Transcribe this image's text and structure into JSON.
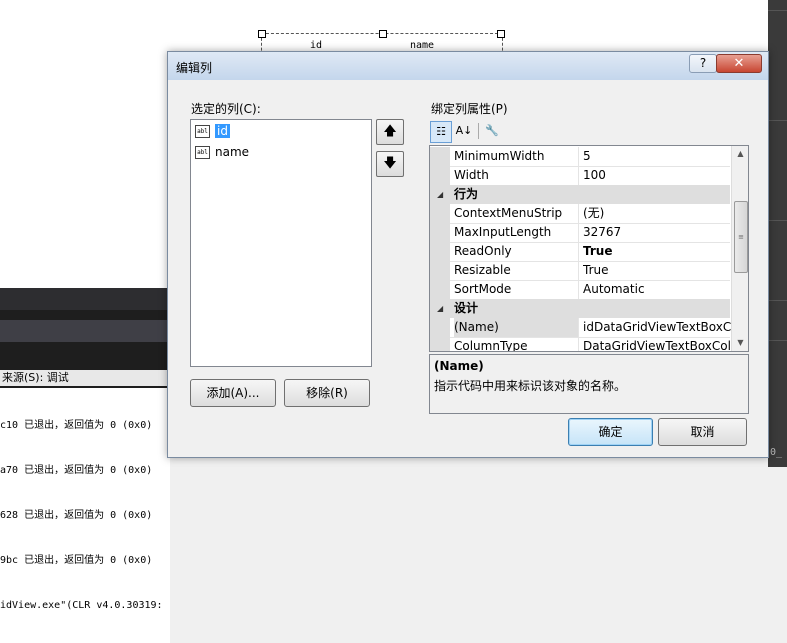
{
  "background": {
    "grid_headers": [
      "id",
      "name"
    ],
    "output": {
      "source_label": "来源(S):  调试",
      "lines": [
        "c10 已退出，返回值为 0 (0x0)",
        "a70 已退出，返回值为 0 (0x0)",
        "628 已退出，返回值为 0 (0x0)",
        "9bc 已退出，返回值为 0 (0x0)",
        "idView.exe\"(CLR v4.0.30319:"
      ]
    },
    "corner_text": "0_"
  },
  "dialog": {
    "title": "编辑列",
    "help_label": "?",
    "close_label": "✕",
    "selected_columns_label": "选定的列(C):",
    "columns": [
      {
        "label": "id",
        "selected": true,
        "icon_text": "abl"
      },
      {
        "label": "name",
        "selected": false,
        "icon_text": "abl"
      }
    ],
    "move_up_icon": "arrow-up-icon",
    "move_down_icon": "arrow-down-icon",
    "up_glyph": "🡅",
    "down_glyph": "🡇",
    "add_button": "添加(A)...",
    "remove_button": "移除(R)",
    "bound_props_label": "绑定列属性(P)",
    "toolbar": {
      "categorized_glyph": "☷",
      "alpha_glyph": "A↓",
      "pages_glyph": "🔧"
    },
    "properties": [
      {
        "kind": "prop",
        "name": "MinimumWidth",
        "value": "5"
      },
      {
        "kind": "prop",
        "name": "Width",
        "value": "100"
      },
      {
        "kind": "cat",
        "name": "行为"
      },
      {
        "kind": "prop",
        "name": "ContextMenuStrip",
        "value": "(无)"
      },
      {
        "kind": "prop",
        "name": "MaxInputLength",
        "value": "32767"
      },
      {
        "kind": "prop",
        "name": "ReadOnly",
        "value": "True",
        "bold": true
      },
      {
        "kind": "prop",
        "name": "Resizable",
        "value": "True"
      },
      {
        "kind": "prop",
        "name": "SortMode",
        "value": "Automatic"
      },
      {
        "kind": "cat",
        "name": "设计"
      },
      {
        "kind": "prop",
        "name": "(Name)",
        "value": "idDataGridViewTextBoxColumn",
        "selected": true
      },
      {
        "kind": "prop",
        "name": "ColumnType",
        "value": "DataGridViewTextBoxColumn"
      }
    ],
    "description": {
      "title": "(Name)",
      "text": "指示代码中用来标识该对象的名称。"
    },
    "ok_button": "确定",
    "cancel_button": "取消"
  }
}
